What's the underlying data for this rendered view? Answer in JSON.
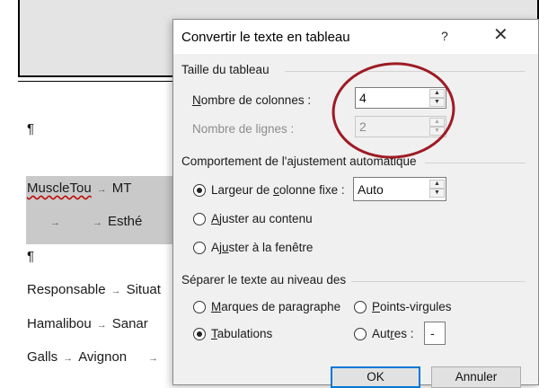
{
  "document": {
    "pilcrow": "¶",
    "rows": [
      {
        "cells": [
          "MuscleTou",
          "MT"
        ]
      },
      {
        "cells": [
          "",
          "Esthé"
        ]
      },
      {
        "cells": [
          "Responsable",
          "Situat"
        ]
      },
      {
        "cells": [
          "Hamalibou",
          "Sanar"
        ]
      },
      {
        "cells": [
          "Galls",
          "Avignon",
          ""
        ]
      }
    ],
    "tab_mark": "→"
  },
  "dialog": {
    "title": "Convertir le texte en tableau",
    "help": "?",
    "close": "✕",
    "table_size": {
      "group_label": "Taille du tableau",
      "columns_label_first": "N",
      "columns_label_rest": "ombre de colonnes :",
      "columns_value": "4",
      "rows_label": "Nombre de lignes :",
      "rows_value": "2"
    },
    "autofit": {
      "group_label": "Comportement de l'ajustement automatique",
      "fixed_label_a": "Largeur de ",
      "fixed_label_u": "c",
      "fixed_label_b": "olonne fixe :",
      "fixed_value": "Auto",
      "content_label_u": "A",
      "content_label_rest": "juster au contenu",
      "window_label_a": "Aj",
      "window_label_u": "u",
      "window_label_b": "ster à la fenêtre"
    },
    "separate": {
      "group_label": "Séparer le texte au niveau des",
      "paragraph_label_u": "M",
      "paragraph_label_rest": "arques de paragraphe",
      "semicolon_label_u": "P",
      "semicolon_label_rest": "oints-virgules",
      "tabs_label_u": "T",
      "tabs_label_rest": "abulations",
      "other_label_a": "Aut",
      "other_label_u": "r",
      "other_label_b": "es :",
      "other_value": "-"
    },
    "ok": "OK",
    "cancel": "Annuler"
  },
  "colors": {
    "annotation": "#9e1b24",
    "accent": "#0078d7"
  }
}
